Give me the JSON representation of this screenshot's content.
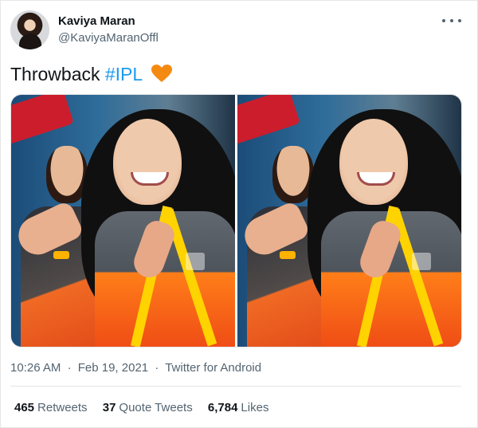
{
  "tweet": {
    "author": {
      "name": "Kaviya Maran",
      "handle": "@KaviyaMaranOffl"
    },
    "text": {
      "before": "Throwback ",
      "hashtag": "#IPL",
      "heart_color": "#f58a13"
    },
    "meta": {
      "time": "10:26 AM",
      "separator_1": "·",
      "date": "Feb 19, 2021",
      "separator_2": "·",
      "source": "Twitter for Android"
    },
    "stats": {
      "retweets": "465",
      "retweets_label": "Retweets",
      "quote_tweets": "37",
      "quote_tweets_label": "Quote Tweets",
      "likes": "6,784",
      "likes_label": "Likes"
    }
  },
  "icons": {
    "more": "more-options-icon",
    "heart": "heart-emoji-icon"
  },
  "colors": {
    "hashtag": "#1d9bf0",
    "text": "#0f1419",
    "muted": "#536471"
  }
}
